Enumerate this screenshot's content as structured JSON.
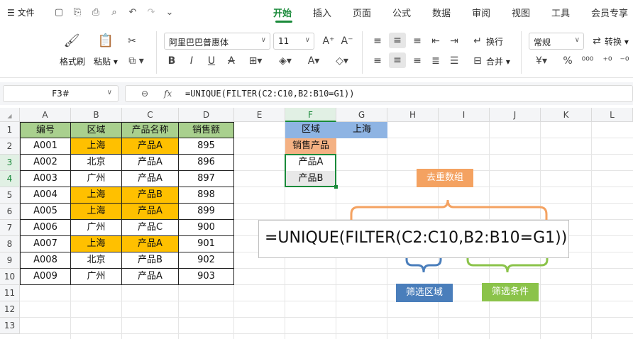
{
  "topbar": {
    "file_label": "文件",
    "tabs": [
      "开始",
      "插入",
      "页面",
      "公式",
      "数据",
      "审阅",
      "视图",
      "工具",
      "会员专享"
    ],
    "active_tab": "开始"
  },
  "ribbon": {
    "format_painter": "格式刷",
    "paste": "粘贴",
    "font_name": "阿里巴巴普惠体",
    "font_size": "11",
    "wrap_text": "换行",
    "merge": "合并",
    "number_format": "常规",
    "convert": "转换"
  },
  "formula_bar": {
    "name_box": "F3#",
    "fx_label": "fx",
    "formula": "=UNIQUE(FILTER(C2:C10,B2:B10=G1))"
  },
  "columns": [
    "A",
    "B",
    "C",
    "D",
    "E",
    "F",
    "G",
    "H",
    "I",
    "J",
    "K",
    "L"
  ],
  "rows": [
    "1",
    "2",
    "3",
    "4",
    "5",
    "6",
    "7",
    "8",
    "9",
    "10",
    "11",
    "12",
    "13"
  ],
  "table": {
    "headers": [
      "编号",
      "区域",
      "产品名称",
      "销售额"
    ],
    "rows": [
      [
        "A001",
        "上海",
        "产品A",
        "895"
      ],
      [
        "A002",
        "北京",
        "产品A",
        "896"
      ],
      [
        "A003",
        "广州",
        "产品A",
        "897"
      ],
      [
        "A004",
        "上海",
        "产品B",
        "898"
      ],
      [
        "A005",
        "上海",
        "产品A",
        "899"
      ],
      [
        "A006",
        "广州",
        "产品C",
        "900"
      ],
      [
        "A007",
        "上海",
        "产品A",
        "901"
      ],
      [
        "A008",
        "北京",
        "产品B",
        "902"
      ],
      [
        "A009",
        "广州",
        "产品A",
        "903"
      ]
    ]
  },
  "side": {
    "f1": "区域",
    "g1": "上海",
    "f2": "销售产品",
    "f3": "产品A",
    "f4": "产品B"
  },
  "annotation": {
    "formula": "=UNIQUE(FILTER(C2:C10,B2:B10=G1))",
    "dedupe_label": "去重数组",
    "filter_range_label": "筛选区域",
    "filter_cond_label": "筛选条件"
  },
  "colors": {
    "accent": "#1a8a3a",
    "header_green": "#a9d08e",
    "highlight_orange": "#ffc000",
    "side_blue": "#8eb4e3",
    "side_peach": "#f4b183",
    "callout_orange": "#f4a261",
    "callout_blue": "#4a7ebb",
    "callout_green": "#8bc34a"
  }
}
